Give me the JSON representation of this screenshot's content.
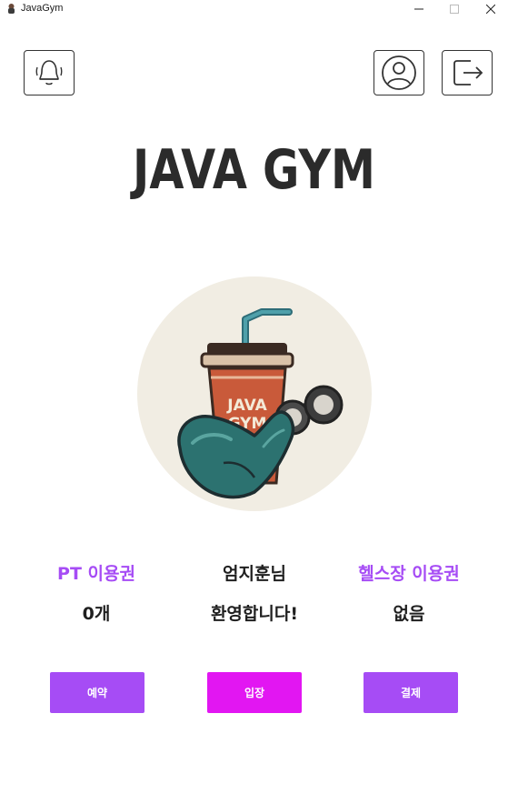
{
  "window": {
    "title": "JavaGym",
    "controls": {
      "minimize": "minimize-icon",
      "maximize": "maximize-icon",
      "close": "close-icon"
    }
  },
  "toolbar": {
    "notification_icon": "bell-icon",
    "profile_icon": "user-circle-icon",
    "logout_icon": "logout-icon"
  },
  "brand": {
    "title": "JAVA GYM",
    "logo_text_line1": "JAVA",
    "logo_text_line2": "GYM"
  },
  "membership": {
    "pt": {
      "label": "PT 이용권",
      "value": "0개"
    },
    "user": {
      "name": "엄지훈님",
      "greeting": "환영합니다!"
    },
    "gym": {
      "label": "헬스장 이용권",
      "value": "없음"
    }
  },
  "actions": {
    "reserve_label": "예약",
    "enter_label": "입장",
    "payment_label": "결제"
  },
  "colors": {
    "accent_purple": "#a64cf5",
    "enter_magenta": "#e216f2",
    "label_purple": "#a64cf5",
    "text_dark": "#1f1f1f",
    "logo_bg": "#f1ede3"
  }
}
